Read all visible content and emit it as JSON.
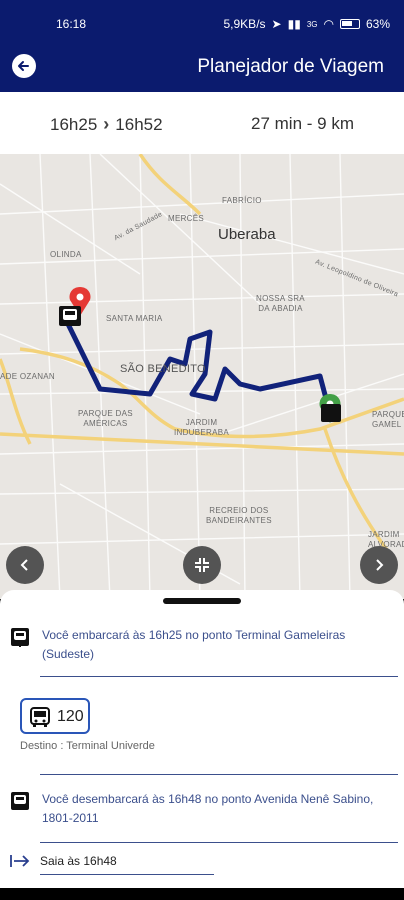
{
  "status": {
    "time": "16:18",
    "right_text": "5,9KB/s",
    "network": "3G",
    "battery": "63%"
  },
  "header": {
    "title": "Planejador de Viagem",
    "back_icon": "back-arrow-icon"
  },
  "summary": {
    "depart": "16h25",
    "arrive": "16h52",
    "duration": "27 min - 9 km"
  },
  "map": {
    "city": "Uberaba",
    "labels": {
      "fabricio": "FABRÍCIO",
      "mercês": "MERCÊS",
      "av_saudade": "Av. da Saudade",
      "olinda": "OLINDA",
      "santa_maria": "SANTA MARIA",
      "sao_benedito": "SÃO BENEDITO",
      "nossa_sra": "NOSSA SRA\nDA ABADIA",
      "ozanan": "ADE OZANAN",
      "parque_americas": "PARQUE DAS\nAMÉRICAS",
      "jardim_induberaba": "JARDIM\nINDUBERABA",
      "recreio": "RECREIO DOS\nBANDEIRANTES",
      "jardim_alvorada": "JARDIM\nALVORADA",
      "parque_gameleiras": "PARQUE\nGAMEL",
      "av_leopoldino": "Av. Leopoldino de Oliveira"
    },
    "route_color": "#11227a",
    "origin_pin_color": "#e53935",
    "dest_pin_color": "#43a047"
  },
  "sheet": {
    "board_text": "Você embarcará às 16h25 no ponto Terminal Gameleiras (Sudeste)",
    "route_number": "120",
    "destination": "Destino : Terminal Univerde",
    "alight_text": "Você desembarcará às 16h48 no ponto Avenida Nenê Sabino, 1801-2011",
    "leave_text": "Saia às 16h48"
  },
  "colors": {
    "primary": "#0b1b6e",
    "accent_text": "#3b4f8c",
    "chip_border": "#2a56b8"
  }
}
